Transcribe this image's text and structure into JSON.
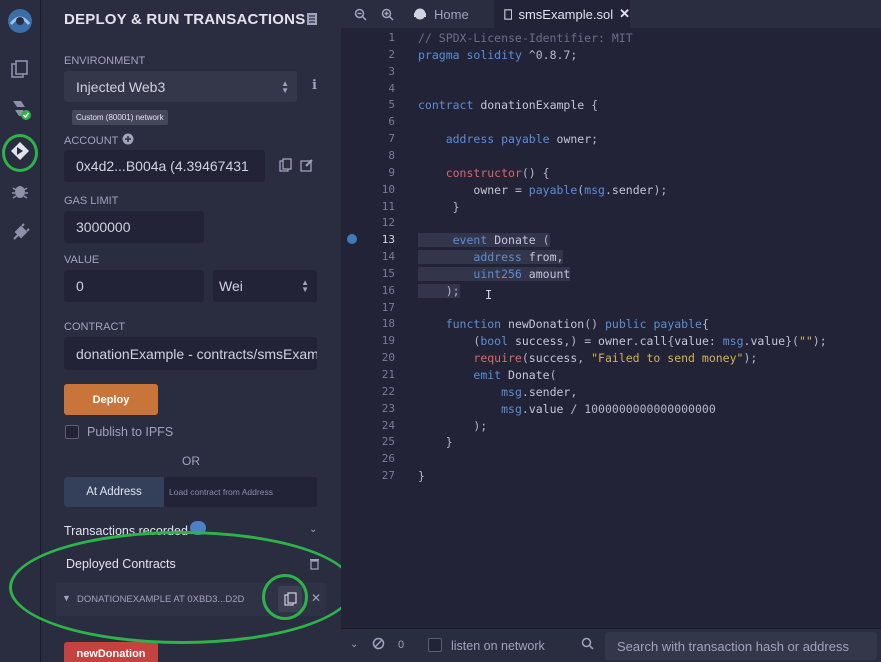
{
  "panel": {
    "title": "DEPLOY & RUN TRANSACTIONS",
    "environment": {
      "label": "ENVIRONMENT",
      "value": "Injected Web3",
      "network_badge": "Custom (80001) network"
    },
    "account": {
      "label": "ACCOUNT",
      "value": "0x4d2...B004a (4.39467431"
    },
    "gas_limit": {
      "label": "GAS LIMIT",
      "value": "3000000"
    },
    "value": {
      "label": "VALUE",
      "amount": "0",
      "unit": "Wei"
    },
    "contract": {
      "label": "CONTRACT",
      "value": "donationExample - contracts/smsExam"
    },
    "deploy_label": "Deploy",
    "publish_label": "Publish to IPFS",
    "or_label": "OR",
    "at_address_label": "At Address",
    "load_contract_placeholder": "Load contract from Address",
    "transactions_recorded_label": "Transactions recorded",
    "deployed_contracts_label": "Deployed Contracts",
    "deployed_instance_label": "DONATIONEXAMPLE AT 0XBD3...D2D",
    "new_donation_label": "newDonation"
  },
  "editor": {
    "tabs": [
      {
        "label": "Home"
      },
      {
        "label": "smsExample.sol"
      }
    ],
    "line_numbers": [
      "1",
      "2",
      "3",
      "4",
      "5",
      "6",
      "7",
      "8",
      "9",
      "10",
      "11",
      "12",
      "13",
      "14",
      "15",
      "16",
      "17",
      "18",
      "19",
      "20",
      "21",
      "22",
      "23",
      "24",
      "25",
      "26",
      "27"
    ],
    "lines": [
      "// SPDX-License-Identifier: MIT",
      "pragma solidity ^0.8.7;",
      "",
      "",
      "contract donationExample {",
      "",
      "    address payable owner;",
      "",
      "    constructor() {",
      "        owner = payable(msg.sender);",
      "     }",
      "",
      "     event Donate (",
      "        address from,",
      "        uint256 amount",
      "    );",
      "",
      "    function newDonation() public payable{",
      "        (bool success,) = owner.call{value: msg.value}(\"\");",
      "        require(success, \"Failed to send money\");",
      "        emit Donate(",
      "            msg.sender,",
      "            msg.value / 1000000000000000000",
      "        );",
      "    }",
      "",
      "}"
    ]
  },
  "terminal": {
    "count": "0",
    "listen_label": "listen on network",
    "search_placeholder": "Search with transaction hash or address"
  },
  "colors": {
    "accent_orange": "#c97539",
    "danger_red": "#c4423f",
    "highlight_green": "#2db34a"
  }
}
